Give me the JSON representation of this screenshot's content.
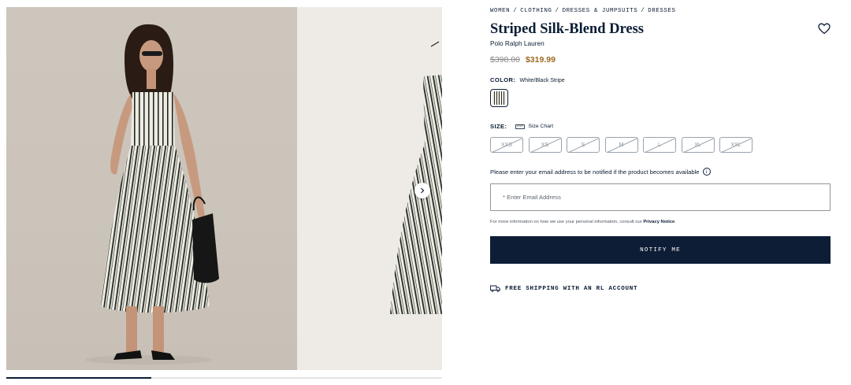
{
  "breadcrumb": [
    "WOMEN",
    "CLOTHING",
    "DRESSES & JUMPSUITS",
    "DRESSES"
  ],
  "breadcrumb_separator": "/",
  "product": {
    "title": "Striped Silk-Blend Dress",
    "brand": "Polo Ralph Lauren",
    "price_original": "$398.00",
    "price_sale": "$319.99"
  },
  "color": {
    "label": "COLOR:",
    "value": "White/Black Stripe"
  },
  "size": {
    "label": "SIZE:",
    "chart_label": "Size Chart",
    "options": [
      "XXS",
      "XS",
      "S",
      "M",
      "L",
      "XL",
      "XXL"
    ]
  },
  "notify": {
    "prompt": "Please enter your email address to be notified if the product becomes available",
    "email_placeholder": "* Enter Email Address",
    "privacy_text": "For more information on how we use your personal information, consult our",
    "privacy_link": "Privacy Notice",
    "privacy_end": ".",
    "button_label": "NOTIFY ME"
  },
  "shipping": {
    "label": "FREE SHIPPING WITH AN RL ACCOUNT"
  },
  "gallery": {
    "images_total": 3,
    "current_image": 1
  },
  "icons": {
    "wishlist": "heart-icon",
    "next": "chevron-right-icon",
    "size_chart": "ruler-icon",
    "info": "info-icon",
    "shipping": "truck-icon"
  },
  "colors": {
    "navy": "#0b1d35",
    "sale_price": "#9c6a20",
    "button_bg": "#0e1d36"
  }
}
